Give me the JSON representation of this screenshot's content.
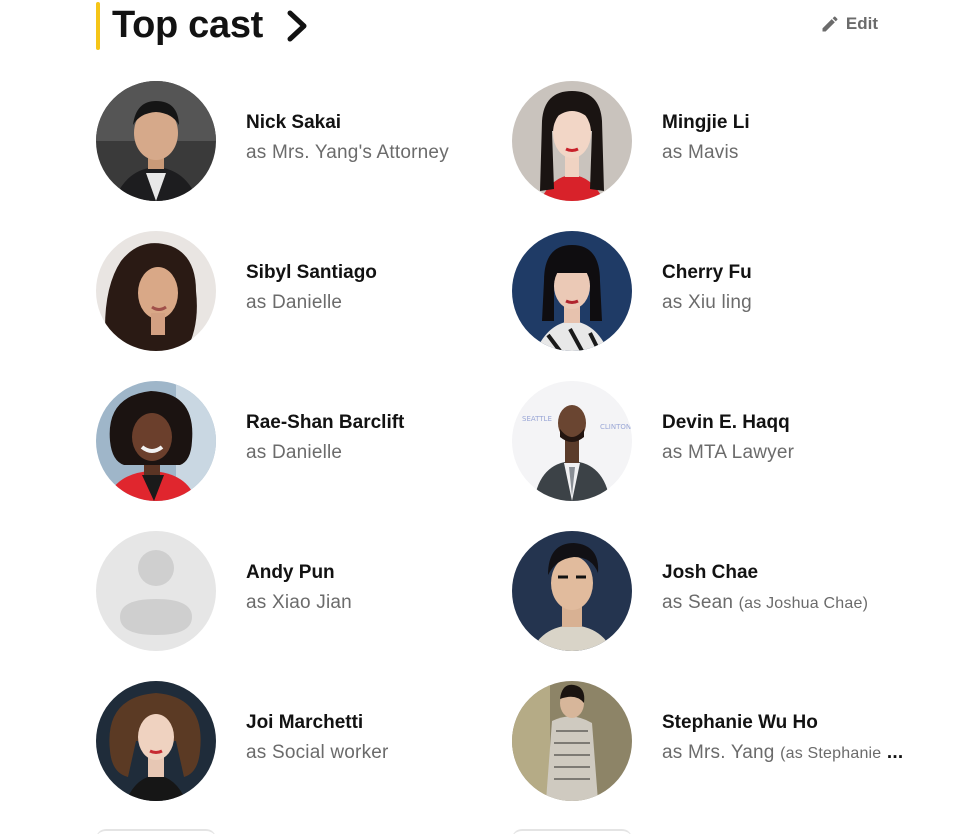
{
  "header": {
    "title": "Top cast",
    "edit_label": "Edit",
    "accent_color": "#f5c518"
  },
  "cast": [
    {
      "name": "Nick Sakai",
      "role": "as Mrs. Yang's Attorney",
      "alias": "",
      "avatar": "photo"
    },
    {
      "name": "Mingjie Li",
      "role": "as Mavis",
      "alias": "",
      "avatar": "photo"
    },
    {
      "name": "Sibyl Santiago",
      "role": "as Danielle",
      "alias": "",
      "avatar": "photo"
    },
    {
      "name": "Cherry Fu",
      "role": "as Xiu ling",
      "alias": "",
      "avatar": "photo"
    },
    {
      "name": "Rae-Shan Barclift",
      "role": "as Danielle",
      "alias": "",
      "avatar": "photo"
    },
    {
      "name": "Devin E. Haqq",
      "role": "as MTA Lawyer",
      "alias": "",
      "avatar": "photo"
    },
    {
      "name": "Andy Pun",
      "role": "as Xiao Jian",
      "alias": "",
      "avatar": "placeholder-person-icon"
    },
    {
      "name": "Josh Chae",
      "role": "as Sean",
      "alias": "(as Joshua Chae)",
      "avatar": "photo"
    },
    {
      "name": "Joi Marchetti",
      "role": "as Social worker",
      "alias": "",
      "avatar": "photo"
    },
    {
      "name": "Stephanie Wu Ho",
      "role": "as Mrs. Yang",
      "alias": "(as Stephanie",
      "truncation": "...",
      "avatar": "photo"
    }
  ]
}
